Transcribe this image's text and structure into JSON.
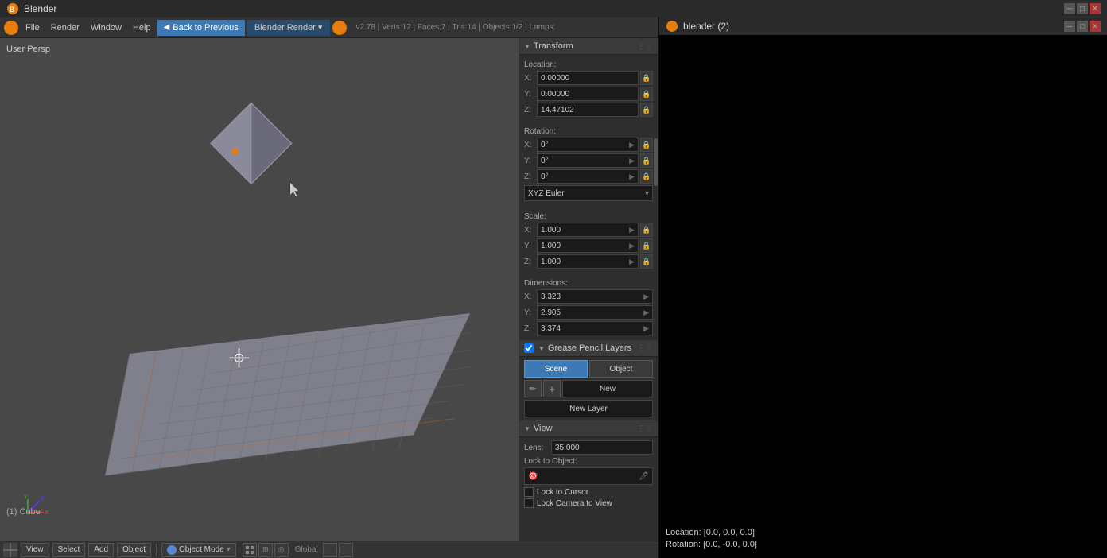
{
  "title_bar": {
    "title": "Blender",
    "second_title": "blender (2)",
    "min": "─",
    "max": "□",
    "close": "✕"
  },
  "menu": {
    "back_button": "Back to Previous",
    "render_engine": "Blender Render",
    "version_stats": "v2.78 | Verts:12 | Faces:7 | Tris:14 | Objects:1/2 | Lamps:",
    "items": [
      "File",
      "Render",
      "Window",
      "Help"
    ]
  },
  "viewport": {
    "label": "User Persp",
    "cube_label": "(1) Cube"
  },
  "bottom_bar": {
    "view": "View",
    "select": "Select",
    "add": "Add",
    "object": "Object",
    "object_mode": "Object Mode",
    "global": "Global"
  },
  "transform_panel": {
    "title": "Transform",
    "location_label": "Location:",
    "x_label": "X:",
    "y_label": "Y:",
    "z_label": "Z:",
    "x_val": "0.00000",
    "y_val": "0.00000",
    "z_val": "14.47102",
    "rotation_label": "Rotation:",
    "rx_val": "0°",
    "ry_val": "0°",
    "rz_val": "0°",
    "euler_label": "XYZ Euler",
    "scale_label": "Scale:",
    "sx_val": "1.000",
    "sy_val": "1.000",
    "sz_val": "1.000",
    "dimensions_label": "Dimensions:",
    "dx_val": "3.323",
    "dy_val": "2.905",
    "dz_val": "3.374"
  },
  "grease_pencil": {
    "title": "Grease Pencil Layers",
    "scene_btn": "Scene",
    "object_btn": "Object",
    "new_label": "New",
    "new_layer_label": "New Layer"
  },
  "view_panel": {
    "title": "View",
    "lens_label": "Lens:",
    "lens_val": "35.000",
    "lock_to_object_label": "Lock to Object:",
    "lock_to_cursor_label": "Lock to Cursor",
    "lock_camera_label": "Lock Camera to View"
  },
  "second_window": {
    "title": "blender (2)",
    "location_text": "Location:  [0.0, 0.0, 0.0]",
    "rotation_text": "Rotation:  [0.0, -0.0, 0.0]"
  }
}
